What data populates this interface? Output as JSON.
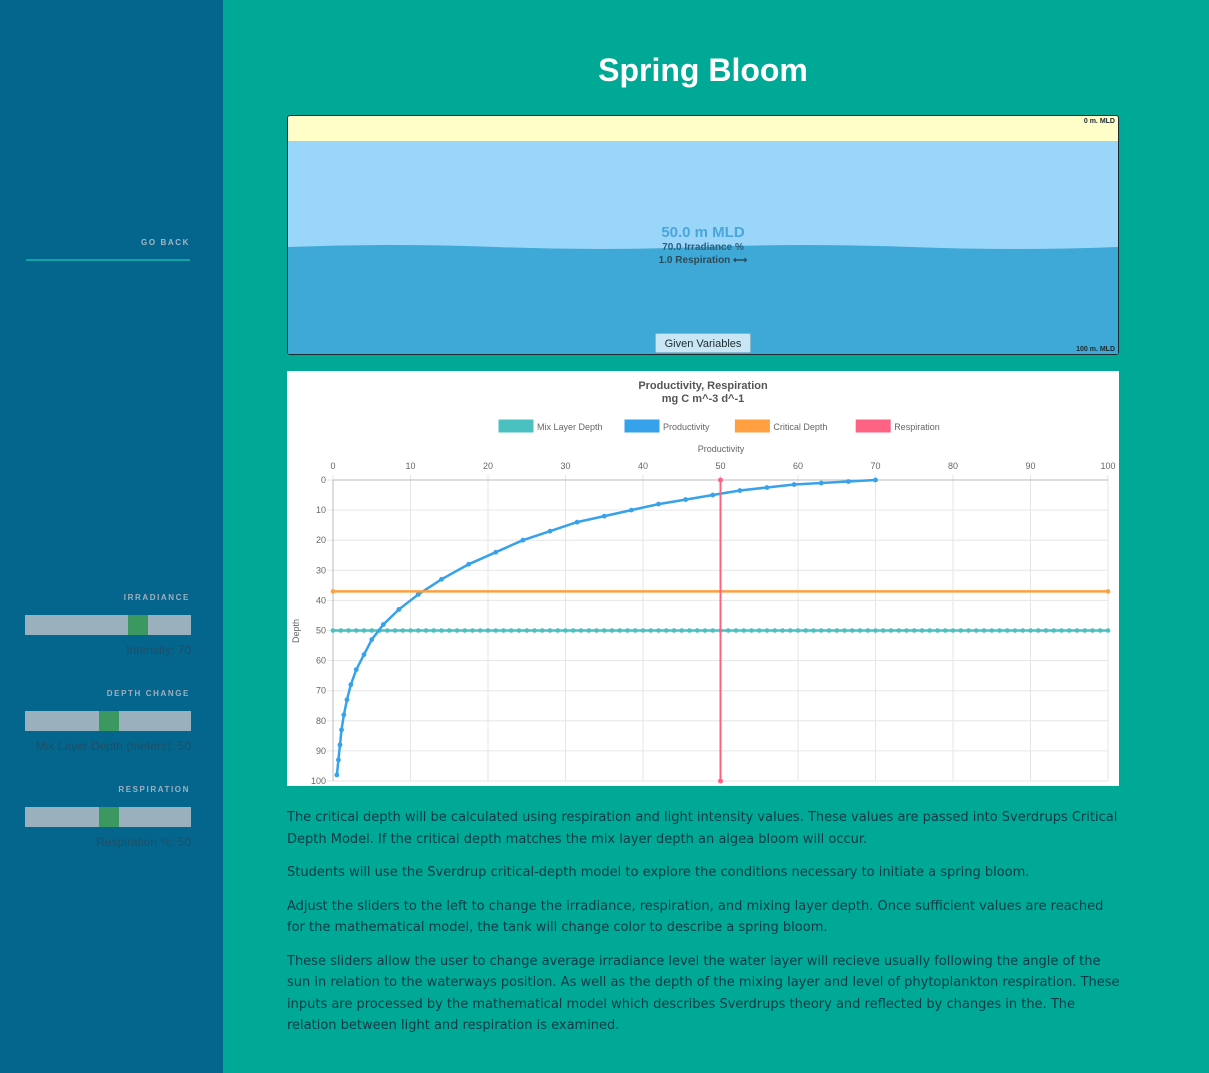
{
  "sidebar": {
    "go_back": "GO BACK",
    "controls": [
      {
        "title": "IRRADIANCE",
        "value_text": "Intensity: 70",
        "value": 70,
        "min": 0,
        "max": 100
      },
      {
        "title": "DEPTH CHANGE",
        "value_text": "Mix Layer Depth (meters): 50",
        "value": 50,
        "min": 0,
        "max": 100
      },
      {
        "title": "RESPIRATION",
        "value_text": "Respiration %: 50",
        "value": 50,
        "min": 0,
        "max": 100
      }
    ]
  },
  "page": {
    "title": "Spring Bloom"
  },
  "tank": {
    "top_label": "0 m. MLD",
    "bottom_label": "100 m. MLD",
    "mld_text": "50.0 m MLD",
    "irradiance_text": "70.0 Irradiance %",
    "respiration_text": "1.0 Respiration ⟷",
    "button_label": "Given Variables",
    "colors": {
      "surface": "#fffec9",
      "mixed_layer": "#99d6fa",
      "deep_layer": "#3ea9d6"
    }
  },
  "chart_data": {
    "type": "line",
    "title": "Productivity, Respiration",
    "subtitle": "mg C m^-3 d^-1",
    "xlabel": "Productivity",
    "ylabel": "Depth",
    "xlim": [
      0,
      100
    ],
    "ylim": [
      0,
      100
    ],
    "x_ticks": [
      "0",
      "10",
      "20",
      "30",
      "40",
      "50",
      "60",
      "70",
      "80",
      "90",
      "100"
    ],
    "y_ticks": [
      "0",
      "10",
      "20",
      "30",
      "40",
      "50",
      "60",
      "70",
      "80",
      "90",
      "100"
    ],
    "y_reversed": true,
    "x_axis_position": "top",
    "grid": true,
    "legend_position": "top",
    "series": [
      {
        "name": "Mix Layer Depth",
        "color": "#4bc0c0",
        "kind": "hline",
        "y": 50
      },
      {
        "name": "Productivity",
        "color": "#36a2eb",
        "kind": "curve",
        "points": [
          [
            70,
            0
          ],
          [
            66.5,
            0.5
          ],
          [
            63,
            1
          ],
          [
            59.5,
            1.5
          ],
          [
            56,
            2.5
          ],
          [
            52.5,
            3.5
          ],
          [
            49,
            5
          ],
          [
            45.5,
            6.5
          ],
          [
            42,
            8
          ],
          [
            38.5,
            10
          ],
          [
            35,
            12
          ],
          [
            31.5,
            14
          ],
          [
            28,
            17
          ],
          [
            24.5,
            20
          ],
          [
            21,
            24
          ],
          [
            17.5,
            28
          ],
          [
            14,
            33
          ],
          [
            11,
            38
          ],
          [
            8.5,
            43
          ],
          [
            6.5,
            48
          ],
          [
            5,
            53
          ],
          [
            4,
            58
          ],
          [
            3,
            63
          ],
          [
            2.3,
            68
          ],
          [
            1.8,
            73
          ],
          [
            1.4,
            78
          ],
          [
            1.1,
            83
          ],
          [
            0.9,
            88
          ],
          [
            0.7,
            93
          ],
          [
            0.5,
            98
          ]
        ]
      },
      {
        "name": "Critical Depth",
        "color": "#ff9f40",
        "kind": "hline",
        "y": 37
      },
      {
        "name": "Respiration",
        "color": "#ff6384",
        "kind": "vline",
        "x": 50
      }
    ]
  },
  "description": [
    "The critical depth will be calculated using respiration and light intensity values. These values are passed into Sverdrups Critical Depth Model. If the critical depth matches the mix layer depth an algea bloom will occur.",
    "Students will use the Sverdrup critical-depth model to explore the conditions necessary to initiate a spring bloom.",
    "Adjust the sliders to the left to change the irradiance, respiration, and mixing layer depth. Once sufficient values are reached for the mathematical model, the tank will change color to describe a spring bloom.",
    "These sliders allow the user to change average irradiance level the water layer will recieve usually following the angle of the sun in relation to the waterways position. As well as the depth of the mixing layer and level of phytoplankton respiration. These inputs are processed by the mathematical model which describes Sverdrups theory and reflected by changes in the. The relation between light and respiration is examined."
  ]
}
